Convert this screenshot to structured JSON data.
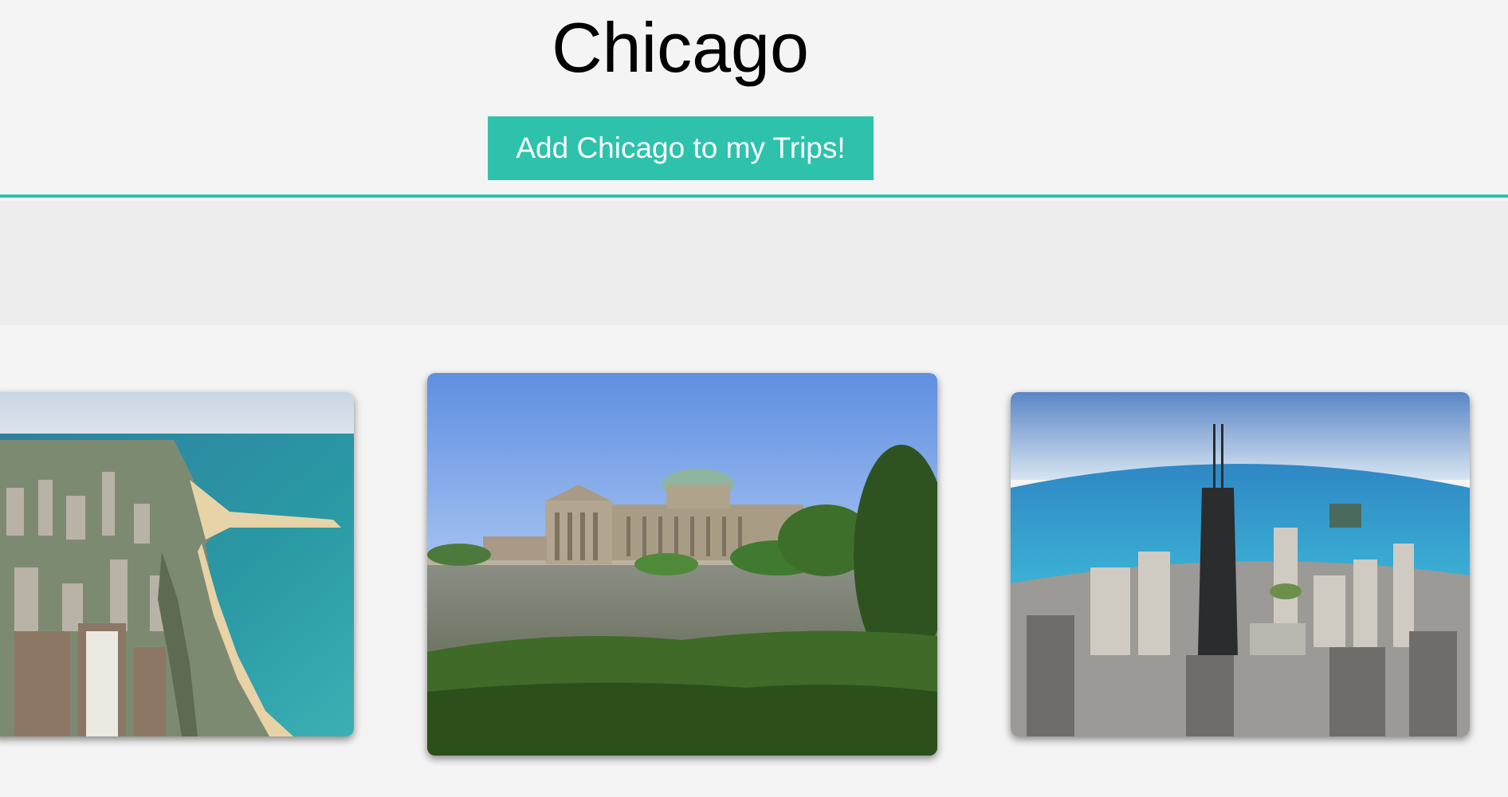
{
  "city": {
    "name": "Chicago",
    "add_button_label": "Add Chicago to my Trips!"
  },
  "theme": {
    "accent": "#2ec2ad",
    "background": "#f4f4f4",
    "band": "#ededed"
  },
  "gallery": {
    "photos": [
      {
        "subject": "aerial-lakeshore-beach"
      },
      {
        "subject": "museum-across-lagoon"
      },
      {
        "subject": "fisheye-skyline-tower"
      }
    ]
  }
}
